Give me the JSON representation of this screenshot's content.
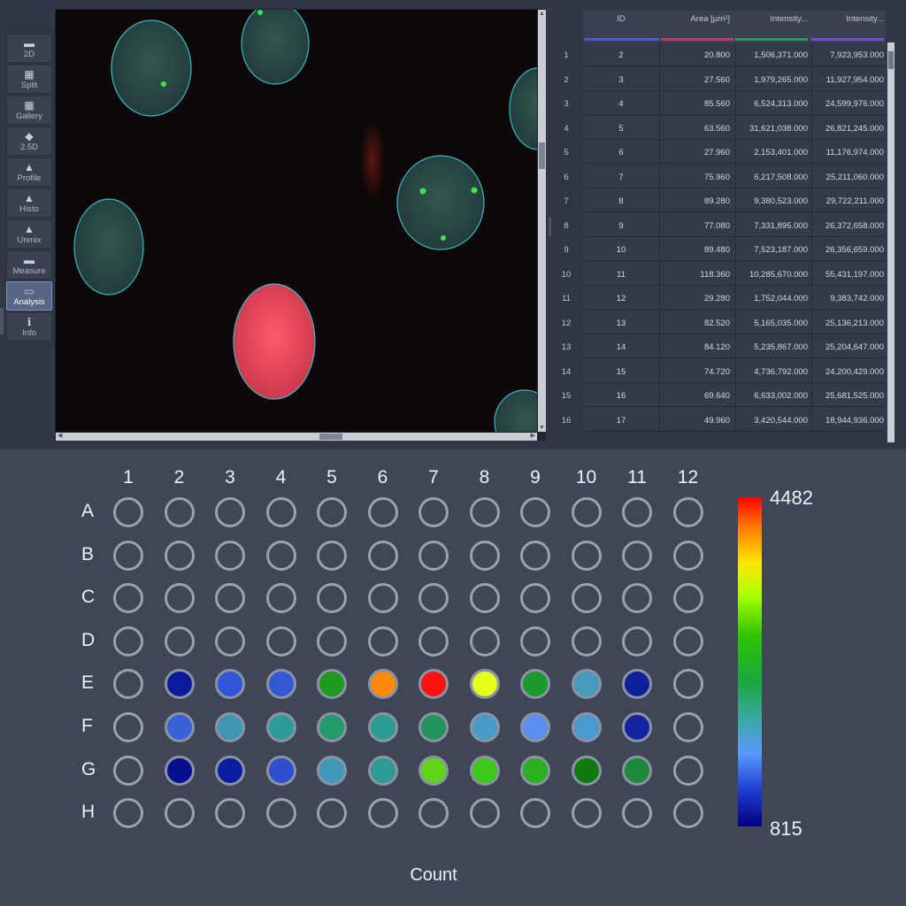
{
  "toolbar": {
    "items": [
      {
        "label": "2D",
        "icon": "square-icon"
      },
      {
        "label": "Split",
        "icon": "split-icon"
      },
      {
        "label": "Gallery",
        "icon": "gallery-icon"
      },
      {
        "label": "2.5D",
        "icon": "surface-icon"
      },
      {
        "label": "Profile",
        "icon": "profile-icon"
      },
      {
        "label": "Histo",
        "icon": "histogram-icon"
      },
      {
        "label": "Unmix",
        "icon": "unmix-icon"
      },
      {
        "label": "Measure",
        "icon": "measure-icon"
      },
      {
        "label": "Analysis",
        "icon": "analysis-icon",
        "active": true
      },
      {
        "label": "Info",
        "icon": "info-icon"
      }
    ]
  },
  "table": {
    "headers": [
      "ID",
      "Area [µm²]",
      "Intensity...",
      "Intensity..."
    ],
    "channel_colors": [
      "#4a5ad0",
      "#c03a6a",
      "#2e9a5a",
      "#7a4ad0"
    ],
    "rows": [
      {
        "n": "1",
        "id": "2",
        "area": "20.800",
        "int1": "1,506,371.000",
        "int2": "7,923,953.000"
      },
      {
        "n": "2",
        "id": "3",
        "area": "27.560",
        "int1": "1,979,265.000",
        "int2": "11,927,954.000"
      },
      {
        "n": "3",
        "id": "4",
        "area": "85.560",
        "int1": "6,524,313.000",
        "int2": "24,599,976.000"
      },
      {
        "n": "4",
        "id": "5",
        "area": "63.560",
        "int1": "31,621,038.000",
        "int2": "26,821,245.000"
      },
      {
        "n": "5",
        "id": "6",
        "area": "27.960",
        "int1": "2,153,401.000",
        "int2": "11,176,974.000"
      },
      {
        "n": "6",
        "id": "7",
        "area": "75.960",
        "int1": "6,217,508.000",
        "int2": "25,211,060.000"
      },
      {
        "n": "7",
        "id": "8",
        "area": "89.280",
        "int1": "9,380,523.000",
        "int2": "29,722,211.000"
      },
      {
        "n": "8",
        "id": "9",
        "area": "77.080",
        "int1": "7,331,895.000",
        "int2": "26,372,658.000"
      },
      {
        "n": "9",
        "id": "10",
        "area": "89.480",
        "int1": "7,523,187.000",
        "int2": "26,356,659.000"
      },
      {
        "n": "10",
        "id": "11",
        "area": "118.360",
        "int1": "10,285,670.000",
        "int2": "55,431,197.000"
      },
      {
        "n": "11",
        "id": "12",
        "area": "29.280",
        "int1": "1,752,044.000",
        "int2": "9,383,742.000"
      },
      {
        "n": "12",
        "id": "13",
        "area": "82.520",
        "int1": "5,165,035.000",
        "int2": "25,136,213.000"
      },
      {
        "n": "13",
        "id": "14",
        "area": "84.120",
        "int1": "5,235,867.000",
        "int2": "25,204,647.000"
      },
      {
        "n": "14",
        "id": "15",
        "area": "74.720",
        "int1": "4,736,792.000",
        "int2": "24,200,429.000"
      },
      {
        "n": "15",
        "id": "16",
        "area": "69.640",
        "int1": "6,633,002.000",
        "int2": "25,681,525.000"
      },
      {
        "n": "16",
        "id": "17",
        "area": "49.960",
        "int1": "3,420,544.000",
        "int2": "18,944,936.000"
      }
    ]
  },
  "plate": {
    "columns": [
      "1",
      "2",
      "3",
      "4",
      "5",
      "6",
      "7",
      "8",
      "9",
      "10",
      "11",
      "12"
    ],
    "rows": [
      "A",
      "B",
      "C",
      "D",
      "E",
      "F",
      "G",
      "H"
    ],
    "empty_fill": "#3e4657",
    "well_colors": {
      "E": [
        null,
        "#0a1a9a",
        "#2f55d8",
        "#3358d4",
        "#1f9a1f",
        "#ff8a0a",
        "#ff1010",
        "#e8ff1a",
        "#1a9a2a",
        "#4a9ac0",
        "#10209a",
        null
      ],
      "F": [
        null,
        "#3a62d8",
        "#3f95b4",
        "#2f9a9a",
        "#239a6a",
        "#2f9a94",
        "#23935e",
        "#4a9ac8",
        "#5c8ef0",
        "#4a9ad0",
        "#1424a0",
        null
      ],
      "G": [
        null,
        "#05108c",
        "#0a1ca0",
        "#2e4ed0",
        "#3f99b8",
        "#2f9a94",
        "#5fd41a",
        "#3ec81a",
        "#2cae1e",
        "#0f7a10",
        "#1c8a3a",
        null
      ]
    }
  },
  "legend": {
    "max": "4482",
    "min": "815"
  },
  "footer": {
    "label": "Count"
  }
}
